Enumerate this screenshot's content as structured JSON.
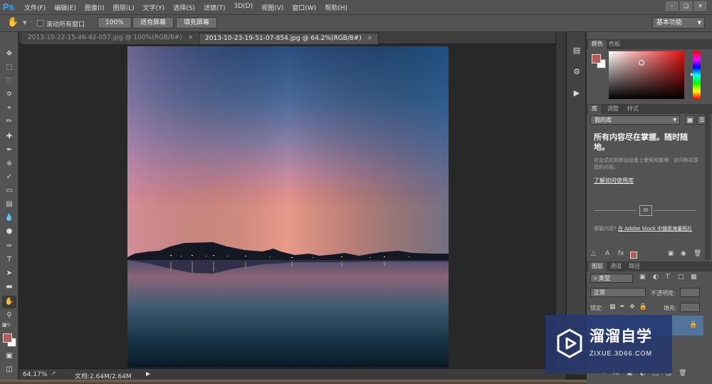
{
  "app": {
    "logo": "Ps",
    "menu": [
      "文件(F)",
      "编辑(E)",
      "图像(I)",
      "图层(L)",
      "文字(Y)",
      "选择(S)",
      "滤镜(T)",
      "3D(D)",
      "视图(V)",
      "窗口(W)",
      "帮助(H)"
    ],
    "window_buttons": [
      "–",
      "❏",
      "✕"
    ]
  },
  "options_bar": {
    "scroll_all_label": "滚动所有窗口",
    "zoom_100": "100%",
    "fit_screen": "适合屏幕",
    "fill_screen": "填充屏幕",
    "workspace": "基本功能"
  },
  "documents": [
    {
      "title": "2013-10-22-15-46-42-057.jpg @ 100%(RGB/8#)",
      "active": false
    },
    {
      "title": "2013-10-23-19-51-07-854.jpg @ 64.2%(RGB/8#)",
      "active": true
    }
  ],
  "status": {
    "zoom": "64.17%",
    "doc_info": "文档:2.64M/2.64M"
  },
  "color_panel": {
    "tabs": [
      "颜色",
      "色板"
    ],
    "foreground": "#b95a55",
    "background": "#ffffff"
  },
  "library_panel": {
    "tabs": [
      "库",
      "调整",
      "样式"
    ],
    "library_name": "我的库",
    "headline": "所有内容尽在掌握。随时随地。",
    "body": "在台式机和移动设备上使用库整理、访问和共享您的内容。",
    "link": "了解如何使用库",
    "stock_badge": "St",
    "search_prefix": "需要内容?",
    "search_link": "在 Adobe Stock 中搜索海量照片"
  },
  "layers_panel": {
    "tabs": [
      "图层",
      "通道",
      "路径"
    ],
    "kind_filter": "⌕ 类型",
    "blend_mode": "正常",
    "opacity_label": "不透明度:",
    "lock_label": "锁定:",
    "fill_label": "填充:"
  },
  "watermark": {
    "title": "溜溜自学",
    "url": "ZIXUE.3D66.COM"
  }
}
